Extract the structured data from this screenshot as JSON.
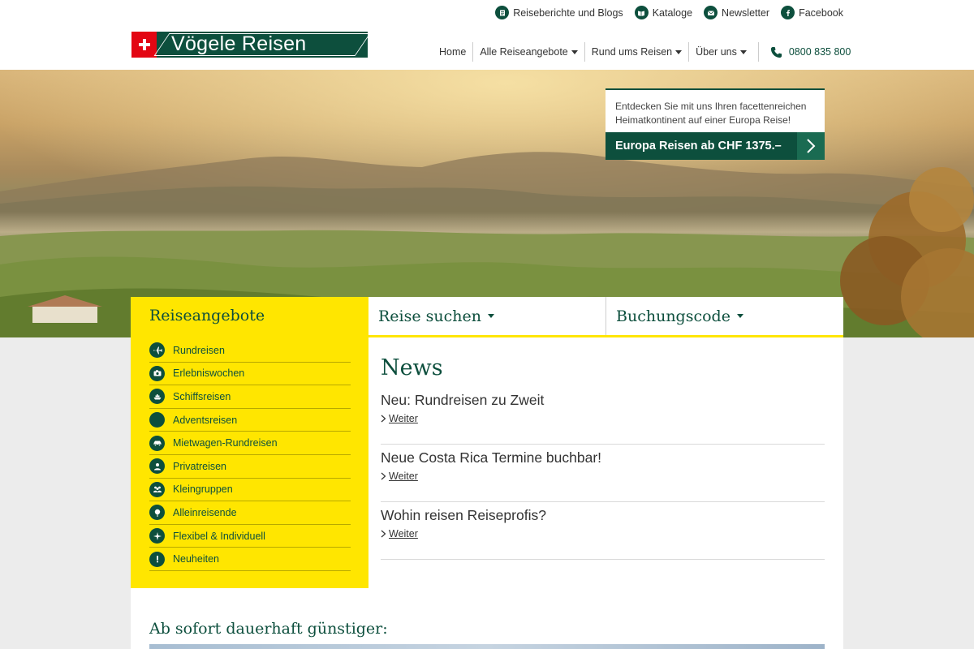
{
  "header": {
    "logo_text": "Vögele Reisen",
    "top_links": [
      {
        "label": "Reiseberichte und Blogs",
        "icon": "blog-icon"
      },
      {
        "label": "Kataloge",
        "icon": "catalog-icon"
      },
      {
        "label": "Newsletter",
        "icon": "newsletter-icon"
      },
      {
        "label": "Facebook",
        "icon": "facebook-icon"
      }
    ],
    "nav": [
      {
        "label": "Home",
        "dropdown": false
      },
      {
        "label": "Alle Reiseangebote",
        "dropdown": true
      },
      {
        "label": "Rund ums Reisen",
        "dropdown": true
      },
      {
        "label": "Über uns",
        "dropdown": true
      }
    ],
    "phone": "0800 835 800"
  },
  "hero": {
    "promo_text": "Entdecken Sie mit uns Ihren facettenreichen Heimatkontinent auf einer Europa Reise!",
    "promo_button": "Europa Reisen ab CHF 1375.–"
  },
  "sidebar": {
    "title": "Reiseangebote",
    "items": [
      {
        "label": "Rundreisen",
        "icon": "airplane-icon"
      },
      {
        "label": "Erlebniswochen",
        "icon": "camera-icon"
      },
      {
        "label": "Schiffsreisen",
        "icon": "ship-icon"
      },
      {
        "label": "Adventsreisen",
        "icon": "advent-icon"
      },
      {
        "label": "Mietwagen-Rundreisen",
        "icon": "car-icon"
      },
      {
        "label": "Privatreisen",
        "icon": "private-icon"
      },
      {
        "label": "Kleingruppen",
        "icon": "group-icon"
      },
      {
        "label": "Alleinreisende",
        "icon": "single-traveler-icon"
      },
      {
        "label": "Flexibel & Individuell",
        "icon": "compass-icon"
      },
      {
        "label": "Neuheiten",
        "icon": "exclamation-icon"
      }
    ]
  },
  "tabs": [
    {
      "label": "Reise suchen"
    },
    {
      "label": "Buchungscode"
    }
  ],
  "news": {
    "title": "News",
    "items": [
      {
        "headline": "Neu: Rundreisen zu Zweit",
        "more": "Weiter"
      },
      {
        "headline": "Neue Costa Rica Termine buchbar!",
        "more": "Weiter"
      },
      {
        "headline": "Wohin reisen Reiseprofis?",
        "more": "Weiter"
      }
    ]
  },
  "section": {
    "title": "Ab sofort dauerhaft günstiger:"
  },
  "colors": {
    "brand_green": "#0d4f3d",
    "brand_yellow": "#ffe600",
    "brand_red": "#e30613"
  }
}
